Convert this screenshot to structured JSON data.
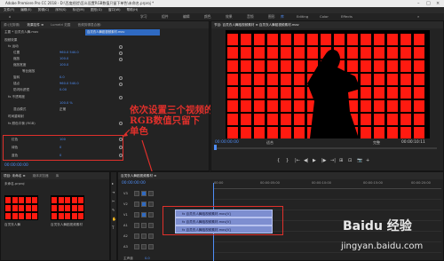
{
  "app": {
    "title": "Adobe Premiere Pro CC 2018 - D:\\百度经验\\怎么设置RGB数值只留下单色\\未命名.prproj *"
  },
  "menu": [
    "文件(F)",
    "编辑(E)",
    "剪辑(C)",
    "序列(S)",
    "标记(M)",
    "图形(G)",
    "窗口(W)",
    "帮助(H)"
  ],
  "workspaces": [
    "学习",
    "组件",
    "编辑",
    "颜色",
    "效果",
    "音频",
    "图形",
    "库",
    "Editing",
    "Color",
    "Effects"
  ],
  "effect_controls": {
    "tabs": [
      "效果控件 ≡",
      "Lumetri 范围",
      "源:(无剪辑)",
      "音频剪辑混合器:"
    ],
    "source_label": "主要 * 百灵衣人舞.mov",
    "sequence_label": "百灵衣人舞蹈视频素材.mov",
    "sections": {
      "video": "视频效果",
      "motion": "fx 运动",
      "position": "位置",
      "scale": "缩放",
      "scale_width": "缩放宽度",
      "uniform": "等比缩放",
      "rotation": "旋转",
      "anchor": "锚点",
      "flicker": "防闪烁滤镜",
      "opacity": "fx 不透明度",
      "blend": "混合模式",
      "timeremap": "时间重映射",
      "channel": "fx 颜色平衡 (RGB)"
    },
    "values": {
      "position": "960.0   540.0",
      "scale": "100.0",
      "scale_width": "100.0",
      "rotation": "0.0",
      "anchor": "960.0   540.0",
      "flicker": "0.00",
      "opacity": "100.0 %",
      "blend": "正常"
    },
    "rgb": [
      {
        "label": "红色",
        "value": "100"
      },
      {
        "label": "绿色",
        "value": "0"
      },
      {
        "label": "蓝色",
        "value": "0"
      }
    ],
    "timecode": "00:00:00:00"
  },
  "annotation": {
    "line1": "依次设置三个视频的",
    "line2": "RGB数值只留下",
    "line3": "单色"
  },
  "program_monitor": {
    "tab": "节目: 百灵衣人舞蹈视频素材 ≡  百灵衣人舞蹈视频素材.mov",
    "timecode_left": "00:00:00:00",
    "fit": "适合",
    "quality": "完整",
    "timecode_right": "00:00:10:11",
    "controls": [
      "{",
      "}",
      "|←",
      "◀|",
      "▶",
      "|▶",
      "→|",
      "⊞",
      "⊡",
      "📷",
      "+"
    ]
  },
  "project": {
    "tabs": [
      "项目: 未命名 ≡",
      "媒体浏览器",
      "库"
    ],
    "path": "未命名.prproj",
    "items": [
      {
        "label": "百灵衣人舞"
      },
      {
        "label": "百灵衣人舞蹈视频素材"
      }
    ]
  },
  "timeline": {
    "tab": "百灵衣人舞蹈视频素材 ≡",
    "timecode": "00:00:00:00",
    "ruler": [
      "00:00",
      "00:00:05:00",
      "00:00:10:00",
      "00:00:15:00",
      "00:00:20:00"
    ],
    "tracks": [
      "V3",
      "V2",
      "V1",
      "A1",
      "A2",
      "A3"
    ],
    "clips": [
      "fx 百灵衣人舞蹈视频素材.mov[V]",
      "fx 百灵衣人舞蹈视频素材.mov[V]",
      "fx 百灵衣人舞蹈视频素材.mov[V]"
    ],
    "master": "主声道",
    "master_val": "0.0"
  },
  "watermark": {
    "brand": "Baidu 经验",
    "url": "jingyan.baidu.com"
  }
}
